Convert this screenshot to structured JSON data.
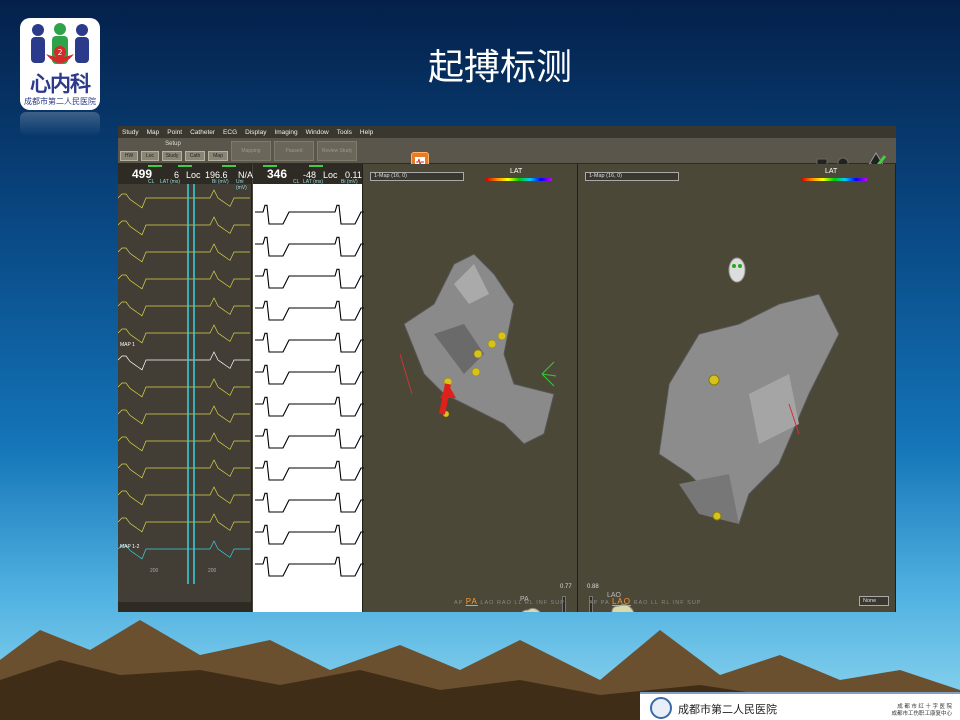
{
  "slide": {
    "title": "起搏标测"
  },
  "logo": {
    "title": "心内科",
    "subtitle": "成都市第二人民医院",
    "badge_number": "2"
  },
  "menu": [
    "Study",
    "Map",
    "Point",
    "Catheter",
    "ECG",
    "Display",
    "Imaging",
    "Window",
    "Tools",
    "Help"
  ],
  "toolbar": {
    "setup_label": "Setup",
    "tabs": [
      "HW",
      "Loc",
      "Study",
      "Cath",
      "Map"
    ],
    "mapping_label": "Mapping",
    "paused_label": "Paused",
    "review_label": "Review Study"
  },
  "ecg_left": {
    "cl_value": "499",
    "cl_label": "CL",
    "lat_value": "6",
    "lat_label": "LAT (ms)",
    "loc_label": "Loc",
    "loc_value": "196.6",
    "bi_value": "N/A",
    "bi_label": "Bi (mV)",
    "uni_label": "Uni (mV)",
    "channel_label": "MAP 1",
    "channel2_label": "MAP 1-2",
    "tick_a": "200",
    "tick_b": "200"
  },
  "ecg_mid": {
    "cl_value": "346",
    "cl_label": "CL",
    "lat_value": "-48",
    "lat_label": "LAT (ms)",
    "loc_label": "Loc",
    "loc_value": "0.11",
    "bi_label": "Bi (mV)"
  },
  "map_left": {
    "selector": "1-Map (16, 0)",
    "legend": "LAT",
    "zoom": "0.77",
    "orientation": "PA",
    "views": [
      "AP",
      "PA",
      "LAO",
      "RAO",
      "LL",
      "RL",
      "INF",
      "SUP"
    ],
    "active_view": "PA"
  },
  "map_right": {
    "selector": "1-Map (16, 0)",
    "legend": "LAT",
    "zoom": "0.88",
    "orientation": "LAO",
    "views": [
      "AP",
      "PA",
      "LAO",
      "RAO",
      "LL",
      "RL",
      "INF",
      "SUP"
    ],
    "active_view": "LAO",
    "none_label": "None"
  },
  "footer": {
    "hospital": "成都市第二人民医院",
    "line1": "成 都 市 红 十 字 医 院",
    "line2": "成都市工伤职工康复中心"
  },
  "colors": {
    "bg_top": "#04204a",
    "bg_bottom": "#8fd7f0",
    "app_bg": "#4a463c",
    "accent_orange": "#e87b24",
    "ecg_yellow": "#d8d44a",
    "ecg_cyan": "#3ccfe0",
    "marker_yellow": "#d6c21c",
    "arrow_red": "#e0201a"
  }
}
